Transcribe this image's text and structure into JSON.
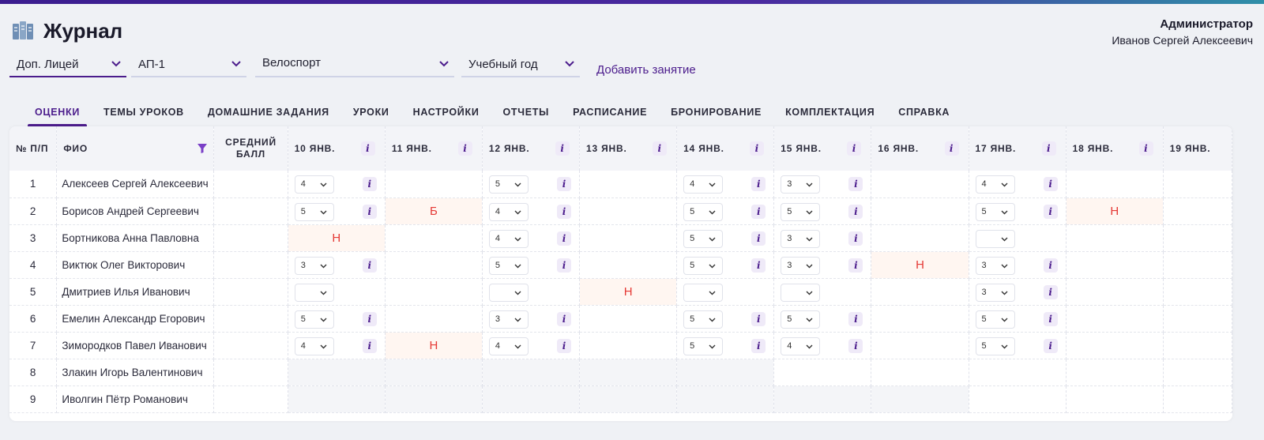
{
  "header": {
    "title": "Журнал",
    "user_role": "Администратор",
    "user_name": "Иванов Сергей Алексеевич"
  },
  "filters": {
    "school": "Доп. Лицей",
    "group": "АП-1",
    "subject": "Велоспорт",
    "year": "Учебный год",
    "add_lesson": "Добавить занятие"
  },
  "tabs": [
    "ОЦЕНКИ",
    "ТЕМЫ УРОКОВ",
    "ДОМАШНИЕ ЗАДАНИЯ",
    "УРОКИ",
    "НАСТРОЙКИ",
    "ОТЧЕТЫ",
    "РАСПИСАНИЕ",
    "БРОНИРОВАНИЕ",
    "КОМПЛЕКТАЦИЯ",
    "СПРАВКА"
  ],
  "table": {
    "col_num": "№ П/П",
    "col_name": "ФИО",
    "col_avg": "СРЕДНИЙ БАЛЛ",
    "dates": [
      "10 ЯНВ.",
      "11 ЯНВ.",
      "12 ЯНВ.",
      "13 ЯНВ.",
      "14 ЯНВ.",
      "15 ЯНВ.",
      "16 ЯНВ.",
      "17 ЯНВ.",
      "18 ЯНВ.",
      "19 ЯНВ."
    ],
    "rows": [
      {
        "n": "1",
        "name": "Алексеев Сергей Алексеевич",
        "avg": "",
        "cells": [
          {
            "t": "g",
            "v": "4",
            "i": true
          },
          {
            "t": "e"
          },
          {
            "t": "g",
            "v": "5",
            "i": true
          },
          {
            "t": "e"
          },
          {
            "t": "g",
            "v": "4",
            "i": true
          },
          {
            "t": "g",
            "v": "3",
            "i": true
          },
          {
            "t": "e"
          },
          {
            "t": "g",
            "v": "4",
            "i": true
          },
          {
            "t": "e"
          },
          {
            "t": "e"
          }
        ]
      },
      {
        "n": "2",
        "name": "Борисов Андрей Сергеевич",
        "avg": "",
        "cells": [
          {
            "t": "g",
            "v": "5",
            "i": true
          },
          {
            "t": "a",
            "v": "Б"
          },
          {
            "t": "g",
            "v": "4",
            "i": true
          },
          {
            "t": "e"
          },
          {
            "t": "g",
            "v": "5",
            "i": true
          },
          {
            "t": "g",
            "v": "5",
            "i": true
          },
          {
            "t": "e"
          },
          {
            "t": "g",
            "v": "5",
            "i": true
          },
          {
            "t": "a",
            "v": "Н"
          },
          {
            "t": "e"
          }
        ]
      },
      {
        "n": "3",
        "name": "Бортникова Анна Павловна",
        "avg": "",
        "cells": [
          {
            "t": "a",
            "v": "Н"
          },
          {
            "t": "e"
          },
          {
            "t": "g",
            "v": "4",
            "i": true
          },
          {
            "t": "e"
          },
          {
            "t": "g",
            "v": "5",
            "i": true
          },
          {
            "t": "g",
            "v": "3",
            "i": true
          },
          {
            "t": "e"
          },
          {
            "t": "g",
            "v": "",
            "i": false
          },
          {
            "t": "e"
          },
          {
            "t": "e"
          }
        ]
      },
      {
        "n": "4",
        "name": "Виктюк Олег Викторович",
        "avg": "",
        "cells": [
          {
            "t": "g",
            "v": "3",
            "i": true
          },
          {
            "t": "e"
          },
          {
            "t": "g",
            "v": "5",
            "i": true
          },
          {
            "t": "e"
          },
          {
            "t": "g",
            "v": "5",
            "i": true
          },
          {
            "t": "g",
            "v": "3",
            "i": true
          },
          {
            "t": "a",
            "v": "Н"
          },
          {
            "t": "g",
            "v": "3",
            "i": true
          },
          {
            "t": "e"
          },
          {
            "t": "e"
          }
        ]
      },
      {
        "n": "5",
        "name": "Дмитриев Илья Иванович",
        "avg": "",
        "cells": [
          {
            "t": "g",
            "v": "",
            "i": false
          },
          {
            "t": "e"
          },
          {
            "t": "g",
            "v": "",
            "i": false
          },
          {
            "t": "a",
            "v": "Н"
          },
          {
            "t": "g",
            "v": "",
            "i": false
          },
          {
            "t": "g",
            "v": "",
            "i": false
          },
          {
            "t": "e"
          },
          {
            "t": "g",
            "v": "3",
            "i": true
          },
          {
            "t": "e"
          },
          {
            "t": "e"
          }
        ]
      },
      {
        "n": "6",
        "name": "Емелин Александр Егорович",
        "avg": "",
        "cells": [
          {
            "t": "g",
            "v": "5",
            "i": true
          },
          {
            "t": "e"
          },
          {
            "t": "g",
            "v": "3",
            "i": true
          },
          {
            "t": "e"
          },
          {
            "t": "g",
            "v": "5",
            "i": true
          },
          {
            "t": "g",
            "v": "5",
            "i": true
          },
          {
            "t": "e"
          },
          {
            "t": "g",
            "v": "5",
            "i": true
          },
          {
            "t": "e"
          },
          {
            "t": "e"
          }
        ]
      },
      {
        "n": "7",
        "name": "Зимородков Павел Иванович",
        "avg": "",
        "cells": [
          {
            "t": "g",
            "v": "4",
            "i": true
          },
          {
            "t": "a",
            "v": "Н"
          },
          {
            "t": "g",
            "v": "4",
            "i": true
          },
          {
            "t": "e"
          },
          {
            "t": "g",
            "v": "5",
            "i": true
          },
          {
            "t": "g",
            "v": "4",
            "i": true
          },
          {
            "t": "e"
          },
          {
            "t": "g",
            "v": "5",
            "i": true
          },
          {
            "t": "e"
          },
          {
            "t": "e"
          }
        ]
      },
      {
        "n": "8",
        "name": "Злакин Игорь Валентинович",
        "avg": "",
        "cells": [
          {
            "t": "d"
          },
          {
            "t": "d"
          },
          {
            "t": "d"
          },
          {
            "t": "d"
          },
          {
            "t": "d"
          },
          {
            "t": "e"
          },
          {
            "t": "e"
          },
          {
            "t": "e"
          },
          {
            "t": "e"
          },
          {
            "t": "e"
          }
        ]
      },
      {
        "n": "9",
        "name": "Иволгин Пётр  Романович",
        "avg": "",
        "cells": [
          {
            "t": "d"
          },
          {
            "t": "d"
          },
          {
            "t": "d"
          },
          {
            "t": "d"
          },
          {
            "t": "d"
          },
          {
            "t": "d"
          },
          {
            "t": "d"
          },
          {
            "t": "e"
          },
          {
            "t": "e"
          },
          {
            "t": "e"
          }
        ]
      }
    ]
  },
  "colors": {
    "accent": "#4b1c8c",
    "absent": "#e53935",
    "absent_bg": "#fff6f1",
    "disabled_bg": "#f4f5f8"
  }
}
